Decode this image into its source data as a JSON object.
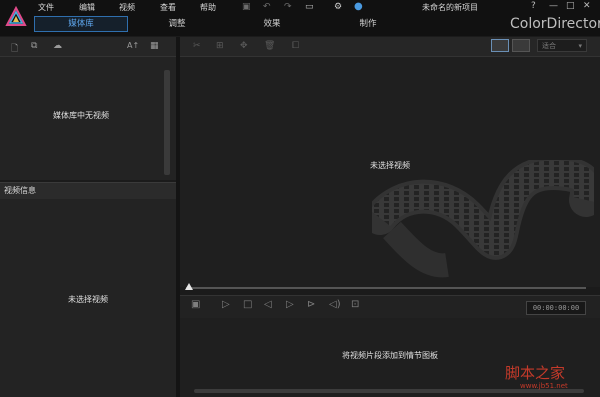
{
  "menu": {
    "file": "文件",
    "edit": "编辑",
    "video": "视频",
    "view": "查看",
    "help": "帮助"
  },
  "project_title": "未命名的新项目",
  "brand": "ColorDirector",
  "tabs": {
    "media": "媒体库",
    "adjust": "调整",
    "effects": "效果",
    "produce": "制作"
  },
  "media_panel": {
    "empty_text": "媒体库中无视频",
    "sort_label": "A↑"
  },
  "video_info": {
    "header": "视频信息",
    "empty_text": "未选择视频"
  },
  "preview": {
    "empty_text": "未选择视频",
    "fit_option": "适合"
  },
  "player": {
    "timecode": "00:00:00:00"
  },
  "storyboard": {
    "hint": "将视频片段添加到情节图板"
  },
  "watermark": {
    "text": "脚本之家",
    "url": "www.jb51.net"
  },
  "window_buttons": {
    "help": "?",
    "minimize": "—",
    "maximize": "□",
    "close": "✕"
  },
  "colors": {
    "accent": "#2f6fae",
    "background": "#1b1b1b",
    "watermark": "#c43a2a"
  }
}
